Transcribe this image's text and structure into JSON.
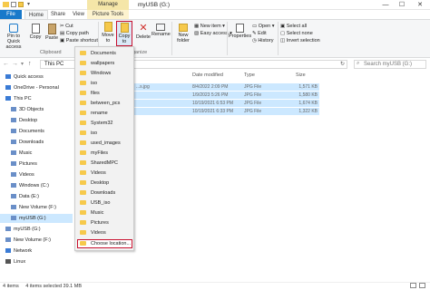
{
  "window": {
    "title": "myUSB (G:)",
    "manage_tab": "Manage",
    "minimize_glyph": "—",
    "maximize_glyph": "☐",
    "close_glyph": "✕"
  },
  "tabs": {
    "file": "File",
    "home": "Home",
    "share": "Share",
    "view": "View",
    "picture_tools": "Picture Tools"
  },
  "ribbon": {
    "pin": "Pin to Quick access",
    "copy": "Copy",
    "paste": "Paste",
    "cut": "Cut",
    "copy_path": "Copy path",
    "paste_shortcut": "Paste shortcut",
    "move_to": "Move to",
    "copy_to": "Copy to",
    "delete": "Delete",
    "rename": "Rename",
    "new_folder": "New folder",
    "new_item": "New item",
    "easy_access": "Easy access",
    "properties": "Properties",
    "open": "Open",
    "edit": "Edit",
    "history": "History",
    "select_all": "Select all",
    "select_none": "Select none",
    "invert_selection": "Invert selection",
    "clipboard_group": "Clipboard",
    "organize_group": "ganize"
  },
  "address": {
    "path": "This PC",
    "search_placeholder": "Search myUSB (G:)"
  },
  "nav": {
    "items": [
      {
        "label": "Quick access",
        "indent": 0
      },
      {
        "label": "OneDrive - Personal",
        "indent": 0
      },
      {
        "label": "This PC",
        "indent": 0
      },
      {
        "label": "3D Objects",
        "indent": 1
      },
      {
        "label": "Desktop",
        "indent": 1
      },
      {
        "label": "Documents",
        "indent": 1
      },
      {
        "label": "Downloads",
        "indent": 1
      },
      {
        "label": "Music",
        "indent": 1
      },
      {
        "label": "Pictures",
        "indent": 1
      },
      {
        "label": "Videos",
        "indent": 1
      },
      {
        "label": "Windows (C:)",
        "indent": 1
      },
      {
        "label": "Data (E:)",
        "indent": 1
      },
      {
        "label": "New Volume (F:)",
        "indent": 1
      },
      {
        "label": "myUSB (G:)",
        "indent": 1,
        "selected": true
      },
      {
        "label": "myUSB (G:)",
        "indent": 0
      },
      {
        "label": "New Volume (F:)",
        "indent": 0
      },
      {
        "label": "Network",
        "indent": 0
      },
      {
        "label": "Linux",
        "indent": 0
      }
    ]
  },
  "columns": {
    "modified": "Date modified",
    "type": "Type",
    "size": "Size"
  },
  "files": [
    {
      "name": "...s.jpg",
      "modified": "8/4/2022 2:09 PM",
      "type": "JPG File",
      "size": "1,571 KB"
    },
    {
      "name": "",
      "modified": "1/9/2023 5:26 PM",
      "type": "JPG File",
      "size": "1,580 KB"
    },
    {
      "name": "",
      "modified": "10/19/2021 6:53 PM",
      "type": "JPG File",
      "size": "1,674 KB"
    },
    {
      "name": "",
      "modified": "10/19/2021 6:33 PM",
      "type": "JPG File",
      "size": "1,322 KB"
    }
  ],
  "copy_menu": {
    "items": [
      "Documents",
      "wallpapers",
      "Windows",
      "iso",
      "files",
      "between_pcs",
      "rename",
      "System32",
      "iso",
      "used_images",
      "myFiles",
      "SharedMPC",
      "Videos",
      "Desktop",
      "Downloads",
      "USB_iso",
      "Music",
      "Pictures",
      "Videos"
    ],
    "choose_location": "Choose location..."
  },
  "status": {
    "items": "4 items",
    "selected": "4 items selected  39.1 MB"
  },
  "colors": {
    "accent": "#1979ca",
    "selection": "#cce8ff",
    "highlight": "#c8102e",
    "folder": "#f6c94b"
  }
}
